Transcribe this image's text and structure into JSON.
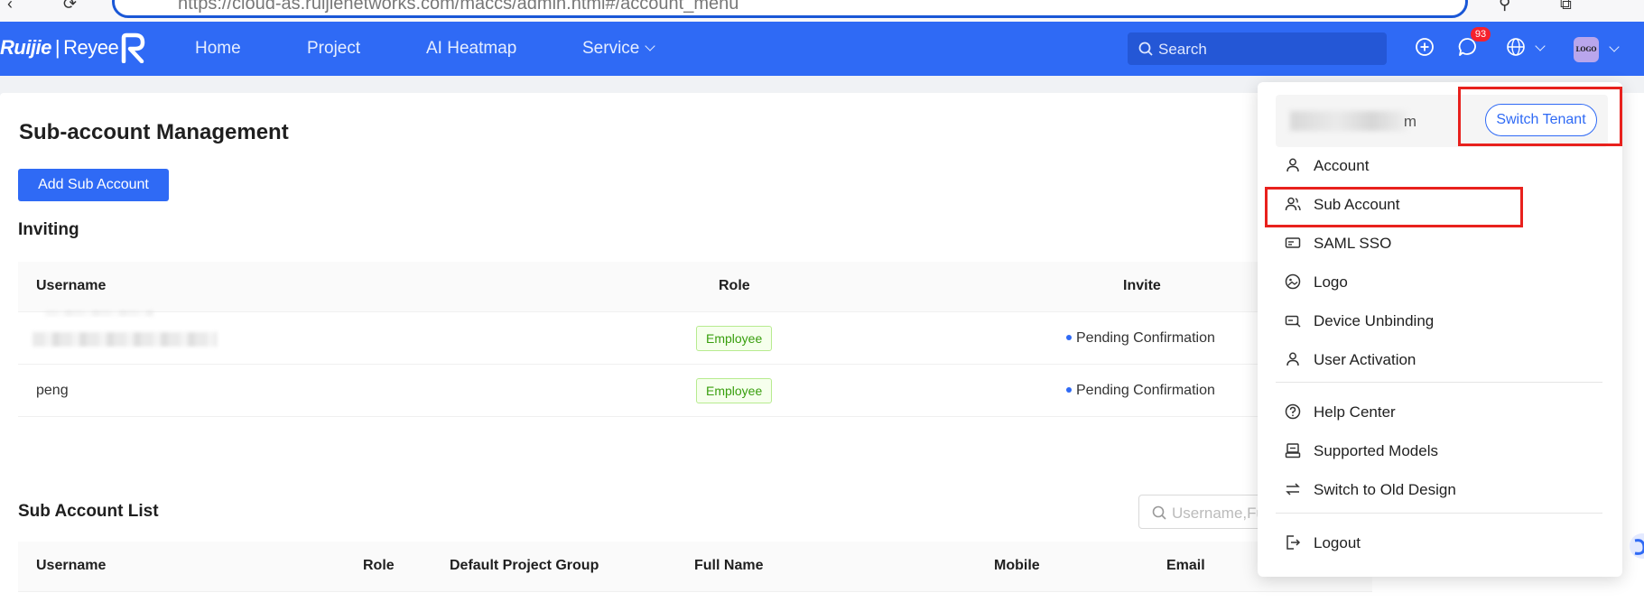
{
  "browser": {
    "url": "https://cloud-as.ruijienetworks.com/maccs/admin.html#/account_menu"
  },
  "nav": {
    "brand": "Ruijie",
    "brand_sep": "|",
    "brand_sub": "Reyee",
    "items": [
      {
        "label": "Home"
      },
      {
        "label": "Project"
      },
      {
        "label": "AI Heatmap"
      },
      {
        "label": "Service"
      }
    ],
    "search_placeholder": "Search",
    "notification_count": "93",
    "avatar_text": "LOGO"
  },
  "page": {
    "title": "Sub-account Management",
    "add_button": "Add Sub Account",
    "inviting": {
      "title": "Inviting",
      "columns": [
        "Username",
        "Role",
        "Invite"
      ],
      "rows": [
        {
          "username": "",
          "role": "Employee",
          "status": "Pending Confirmation"
        },
        {
          "username": "peng",
          "role": "Employee",
          "status": "Pending Confirmation"
        }
      ]
    },
    "list": {
      "title": "Sub Account List",
      "filter_placeholder": "Username,Fu",
      "columns": [
        "Username",
        "Role",
        "Default Project Group",
        "Full Name",
        "Mobile",
        "Email"
      ]
    }
  },
  "menu": {
    "user_partial": "m",
    "switch_tenant": "Switch Tenant",
    "items": [
      {
        "label": "Account",
        "icon": "user-icon"
      },
      {
        "label": "Sub Account",
        "icon": "users-icon"
      },
      {
        "label": "SAML SSO",
        "icon": "id-card-icon"
      },
      {
        "label": "Logo",
        "icon": "image-icon"
      },
      {
        "label": "Device Unbinding",
        "icon": "unlink-icon"
      },
      {
        "label": "User Activation",
        "icon": "user-icon"
      }
    ],
    "items2": [
      {
        "label": "Help Center",
        "icon": "help-icon"
      },
      {
        "label": "Supported Models",
        "icon": "model-icon"
      },
      {
        "label": "Switch to Old Design",
        "icon": "swap-icon"
      }
    ],
    "logout": "Logout"
  },
  "colors": {
    "accent": "#2f6af5",
    "highlight": "#e8211d",
    "tag_green": "#389e0d"
  }
}
